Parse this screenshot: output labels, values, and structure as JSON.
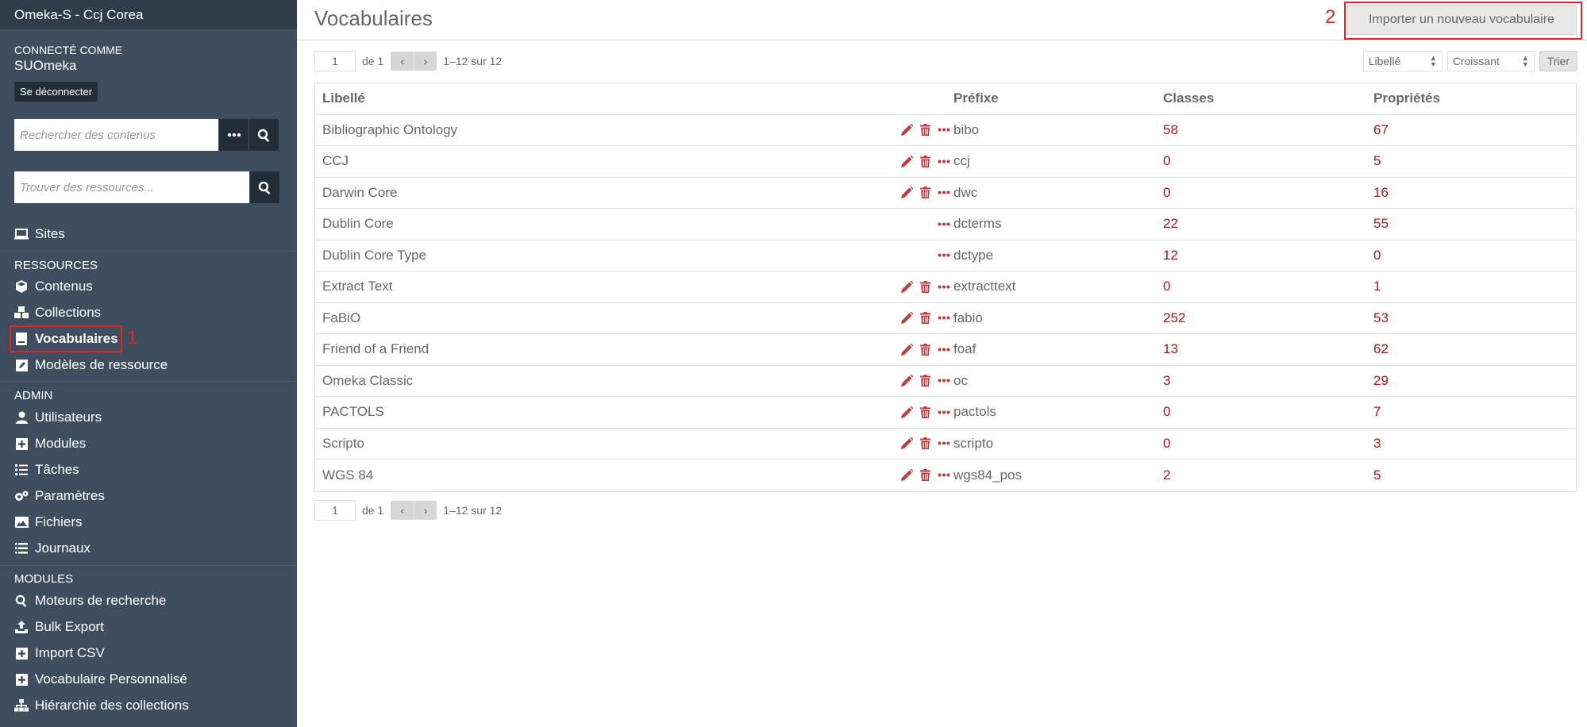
{
  "sidebar": {
    "site_title": "Omeka-S - Ccj Corea",
    "connected_label": "Connecté comme",
    "username": "SUOmeka",
    "logout_label": "Se déconnecter",
    "search_placeholder": "Rechercher des contenus",
    "find_placeholder": "Trouver des ressources...",
    "sites_label": "Sites",
    "resources_heading": "Ressources",
    "resources": [
      {
        "label": "Contenus",
        "icon": "cube-icon"
      },
      {
        "label": "Collections",
        "icon": "cubes-icon"
      },
      {
        "label": "Vocabulaires",
        "icon": "book-icon",
        "active": true
      },
      {
        "label": "Modèles de ressource",
        "icon": "edit-square-icon"
      }
    ],
    "admin_heading": "Admin",
    "admin": [
      {
        "label": "Utilisateurs",
        "icon": "user-icon"
      },
      {
        "label": "Modules",
        "icon": "plus-square-icon"
      },
      {
        "label": "Tâches",
        "icon": "tasks-icon"
      },
      {
        "label": "Paramètres",
        "icon": "cogs-icon"
      },
      {
        "label": "Fichiers",
        "icon": "image-icon"
      },
      {
        "label": "Journaux",
        "icon": "list-icon"
      }
    ],
    "modules_heading": "Modules",
    "modules": [
      {
        "label": "Moteurs de recherche",
        "icon": "search-icon"
      },
      {
        "label": "Bulk Export",
        "icon": "upload-icon"
      },
      {
        "label": "Import CSV",
        "icon": "plus-square-icon"
      },
      {
        "label": "Vocabulaire Personnalisé",
        "icon": "plus-square-icon"
      },
      {
        "label": "Hiérarchie des collections",
        "icon": "sitemap-icon"
      }
    ]
  },
  "annotations": {
    "one": "1",
    "two": "2"
  },
  "main": {
    "title": "Vocabulaires",
    "import_button": "Importer un nouveau vocabulaire",
    "pagination": {
      "page": "1",
      "of": "de 1",
      "prev": "‹",
      "next": "›",
      "range": "1–12 sur 12"
    },
    "sort": {
      "by": "Libellé",
      "order": "Croissant",
      "button": "Trier"
    },
    "table": {
      "headers": {
        "label": "Libellé",
        "prefix": "Préfixe",
        "classes": "Classes",
        "properties": "Propriétés"
      },
      "rows": [
        {
          "label": "Bibliographic Ontology",
          "prefix": "bibo",
          "classes": "58",
          "properties": "67",
          "editable": true
        },
        {
          "label": "CCJ",
          "prefix": "ccj",
          "classes": "0",
          "properties": "5",
          "editable": true
        },
        {
          "label": "Darwin Core",
          "prefix": "dwc",
          "classes": "0",
          "properties": "16",
          "editable": true
        },
        {
          "label": "Dublin Core",
          "prefix": "dcterms",
          "classes": "22",
          "properties": "55",
          "editable": false
        },
        {
          "label": "Dublin Core Type",
          "prefix": "dctype",
          "classes": "12",
          "properties": "0",
          "editable": false
        },
        {
          "label": "Extract Text",
          "prefix": "extracttext",
          "classes": "0",
          "properties": "1",
          "editable": true
        },
        {
          "label": "FaBiO",
          "prefix": "fabio",
          "classes": "252",
          "properties": "53",
          "editable": true
        },
        {
          "label": "Friend of a Friend",
          "prefix": "foaf",
          "classes": "13",
          "properties": "62",
          "editable": true
        },
        {
          "label": "Omeka Classic",
          "prefix": "oc",
          "classes": "3",
          "properties": "29",
          "editable": true
        },
        {
          "label": "PACTOLS",
          "prefix": "pactols",
          "classes": "0",
          "properties": "7",
          "editable": true
        },
        {
          "label": "Scripto",
          "prefix": "scripto",
          "classes": "0",
          "properties": "3",
          "editable": true
        },
        {
          "label": "WGS 84",
          "prefix": "wgs84_pos",
          "classes": "2",
          "properties": "5",
          "editable": true
        }
      ]
    }
  },
  "colors": {
    "sidebar": "#3f4e5e",
    "accent": "#a91919",
    "highlight": "#e02626"
  }
}
